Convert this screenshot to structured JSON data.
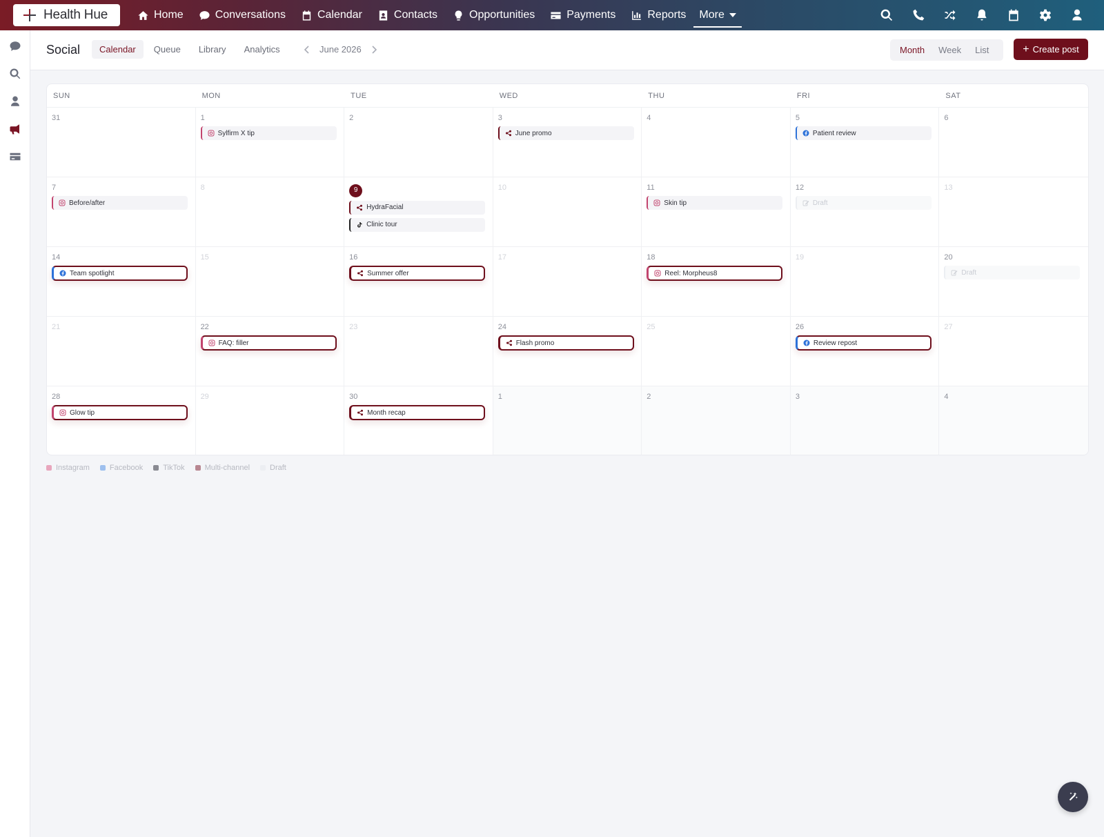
{
  "app": {
    "brand": "Health Hue",
    "colors": {
      "brand": "#6e0f1c",
      "instagram": "#c2446e",
      "facebook": "#2d72d9",
      "tiktok": "#222222"
    }
  },
  "nav": {
    "items": [
      {
        "label": "Home",
        "icon": "home-icon"
      },
      {
        "label": "Conversations",
        "icon": "chat-icon"
      },
      {
        "label": "Calendar",
        "icon": "calendar-icon"
      },
      {
        "label": "Contacts",
        "icon": "contacts-icon"
      },
      {
        "label": "Opportunities",
        "icon": "lightbulb-icon"
      },
      {
        "label": "Payments",
        "icon": "card-icon"
      },
      {
        "label": "Reports",
        "icon": "chart-icon"
      }
    ],
    "more_label": "More",
    "right_icons": [
      "search-icon",
      "phone-icon",
      "shuffle-icon",
      "bell-icon",
      "calendar-icon",
      "gear-icon",
      "user-icon"
    ]
  },
  "rail": [
    "chat-icon",
    "search-icon",
    "user-icon",
    "megaphone-icon",
    "card-icon"
  ],
  "subheader": {
    "title": "Social",
    "tabs": [
      "Calendar",
      "Queue",
      "Library",
      "Analytics"
    ],
    "active_tab": "Calendar",
    "month_label": "June 2026",
    "views": [
      "Month",
      "Week",
      "List"
    ],
    "active_view": "Month",
    "create_label": "Create post"
  },
  "calendar": {
    "weekdays": [
      "SUN",
      "MON",
      "TUE",
      "WED",
      "THU",
      "FRI",
      "SAT"
    ],
    "days": [
      {
        "n": "31",
        "events": []
      },
      {
        "n": "1",
        "events": [
          {
            "label": "Sylfirm X tip",
            "type": "instagram"
          }
        ]
      },
      {
        "n": "2",
        "events": []
      },
      {
        "n": "3",
        "events": [
          {
            "label": "June promo",
            "type": "multi"
          }
        ]
      },
      {
        "n": "4",
        "events": []
      },
      {
        "n": "5",
        "events": [
          {
            "label": "Patient review",
            "type": "facebook"
          }
        ]
      },
      {
        "n": "6",
        "events": []
      },
      {
        "n": "7",
        "events": [
          {
            "label": "Before/after",
            "type": "instagram"
          }
        ]
      },
      {
        "n": "8",
        "muted": true,
        "events": []
      },
      {
        "n": "9",
        "today": true,
        "events": [
          {
            "label": "HydraFacial",
            "type": "multi"
          },
          {
            "label": "Clinic tour",
            "type": "tiktok"
          }
        ]
      },
      {
        "n": "10",
        "muted": true,
        "events": []
      },
      {
        "n": "11",
        "events": [
          {
            "label": "Skin tip",
            "type": "instagram"
          }
        ]
      },
      {
        "n": "12",
        "events": [
          {
            "label": "Draft",
            "type": "draft"
          }
        ]
      },
      {
        "n": "13",
        "muted": true,
        "events": []
      },
      {
        "n": "14",
        "events": [
          {
            "label": "Team spotlight",
            "type": "facebook",
            "highlight": true
          }
        ]
      },
      {
        "n": "15",
        "muted": true,
        "events": []
      },
      {
        "n": "16",
        "events": [
          {
            "label": "Summer offer",
            "type": "multi",
            "highlight": true
          }
        ]
      },
      {
        "n": "17",
        "muted": true,
        "events": []
      },
      {
        "n": "18",
        "events": [
          {
            "label": "Reel: Morpheus8",
            "type": "instagram",
            "highlight": true
          }
        ]
      },
      {
        "n": "19",
        "muted": true,
        "events": []
      },
      {
        "n": "20",
        "events": [
          {
            "label": "Draft",
            "type": "draft"
          }
        ]
      },
      {
        "n": "21",
        "muted": true,
        "events": []
      },
      {
        "n": "22",
        "events": [
          {
            "label": "FAQ: filler",
            "type": "instagram",
            "highlight": true
          }
        ]
      },
      {
        "n": "23",
        "muted": true,
        "events": []
      },
      {
        "n": "24",
        "events": [
          {
            "label": "Flash promo",
            "type": "multi",
            "highlight": true
          }
        ]
      },
      {
        "n": "25",
        "muted": true,
        "events": []
      },
      {
        "n": "26",
        "events": [
          {
            "label": "Review repost",
            "type": "facebook",
            "highlight": true
          }
        ]
      },
      {
        "n": "27",
        "muted": true,
        "events": []
      },
      {
        "n": "28",
        "events": [
          {
            "label": "Glow tip",
            "type": "instagram",
            "highlight": true
          }
        ]
      },
      {
        "n": "29",
        "muted": true,
        "events": []
      },
      {
        "n": "30",
        "events": [
          {
            "label": "Month recap",
            "type": "multi",
            "highlight": true
          }
        ]
      },
      {
        "n": "1",
        "next": true,
        "events": []
      },
      {
        "n": "2",
        "next": true,
        "events": []
      },
      {
        "n": "3",
        "next": true,
        "events": []
      },
      {
        "n": "4",
        "next": true,
        "events": []
      }
    ]
  },
  "legend": [
    {
      "label": "Instagram",
      "color": "#e8a6bd"
    },
    {
      "label": "Facebook",
      "color": "#9ec0ee"
    },
    {
      "label": "TikTok",
      "color": "#8a8b92"
    },
    {
      "label": "Multi-channel",
      "color": "#b88791"
    },
    {
      "label": "Draft",
      "color": "#eceef2"
    }
  ],
  "fab": {
    "icon": "magic-wand-icon"
  }
}
